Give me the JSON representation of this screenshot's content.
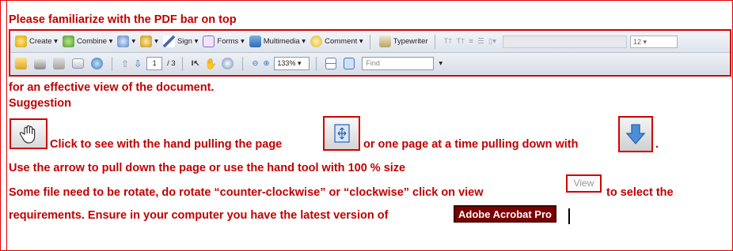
{
  "heading": "Please familiarize with the PDF bar on top",
  "toolbar1": {
    "create": "Create",
    "combine": "Combine",
    "sign": "Sign",
    "forms": "Forms",
    "multimedia": "Multimedia",
    "comment": "Comment",
    "typewriter": "Typewriter",
    "font_size": "12"
  },
  "toolbar2": {
    "page_current": "1",
    "page_total": "/ 3",
    "zoom": "133%",
    "find_placeholder": "Find"
  },
  "text": {
    "line2": "for an effective view of the document.",
    "suggestion": "Suggestion",
    "line4a": "Click to see with the hand pulling the page",
    "line4b": "or one page at a time pulling down with",
    "line4c": ".",
    "line5": "Use the arrow to pull down the page or use the hand tool with 100 % size",
    "line6a": "Some file need to be rotate, do rotate “counter-clockwise” or “clockwise” click on view",
    "line6b": "to select the",
    "line7": "requirements. Ensure in your computer you have the latest version of"
  },
  "view_button": "View",
  "acrobat_label": "Adobe Acrobat Pro",
  "colors": {
    "accent_red": "#c00000",
    "acrobat_bg": "#7a0000"
  },
  "icons": [
    "hand-tool-icon",
    "fit-page-icon",
    "next-page-arrow-icon"
  ]
}
